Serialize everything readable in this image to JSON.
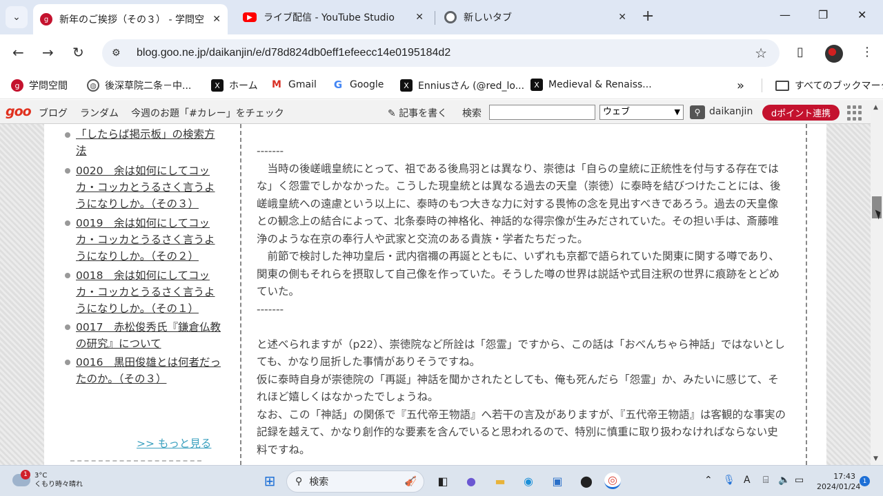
{
  "tabs": [
    {
      "title": "新年のご挨拶（その３） - 学問空",
      "close": "✕",
      "favicon_color": "#c4122e",
      "active": true
    },
    {
      "title": "ライブ配信 - YouTube Studio",
      "close": "✕",
      "favicon_color": "#ff0000",
      "active": false
    },
    {
      "title": "新しいタブ",
      "close": "✕",
      "favicon_color": "#5f6368",
      "active": false
    }
  ],
  "newtab": "+",
  "window": {
    "minimize": "—",
    "restore": "❐",
    "close": "✕"
  },
  "toolbar": {
    "url": "blog.goo.ne.jp/daikanjin/e/d78d824db0eff1efeecc14e0195184d2"
  },
  "bookmarks": [
    {
      "label": "学問空間",
      "icon": "goo-icon"
    },
    {
      "label": "後深草院二条－中...",
      "icon": "globe-icon"
    },
    {
      "label": "ホーム",
      "icon": "x-icon"
    },
    {
      "label": "Gmail",
      "icon": "gmail-icon"
    },
    {
      "label": "Google",
      "icon": "google-icon"
    },
    {
      "label": "Enniusさん (@red_lo...",
      "icon": "x-icon"
    },
    {
      "label": "Medieval & Renaiss...",
      "icon": "x-icon"
    }
  ],
  "bookmarks_overflow": "»",
  "all_bookmarks": "すべてのブックマーク",
  "goo": {
    "logo": "goo",
    "links": [
      "ブログ",
      "ランダム",
      "今週のお題「#カレー」をチェック"
    ],
    "write": "記事を書く",
    "search_label": "検索",
    "select_value": "ウェブ",
    "user": "daikanjin",
    "dpoint": "dポイント連携"
  },
  "sidebar": {
    "items": [
      "「したらば掲示板」の検索方法",
      "0020　余は如何にしてコッカ・コッカとうるさく言うようになりしか。（その３）",
      "0019　余は如何にしてコッカ・コッカとうるさく言うようになりしか。（その２）",
      "0018　余は如何にしてコッカ・コッカとうるさく言うようになりしか。（その１）",
      "0017　赤松俊秀氏『鎌倉仏教の研究』について",
      "0016　黒田俊雄とは何者だったのか。（その３）"
    ],
    "more": ">> もっと見る"
  },
  "article": {
    "p1": "-------",
    "p2": "　当時の後嵯峨皇統にとって、祖である後鳥羽とは異なり、崇徳は「自らの皇統に正統性を付与する存在ではな」く怨霊でしかなかった。こうした現皇統とは異なる過去の天皇（崇徳）に泰時を結びつけたことには、後嵯峨皇統への遠慮という以上に、泰時のもつ大きな力に対する畏怖の念を見出すべきであろう。過去の天皇像との観念上の結合によって、北条泰時の神格化、神話的な得宗像が生みだされていた。その担い手は、斎藤唯浄のような在京の奉行人や武家と交流のある貴族・学者たちだった。",
    "p3": "　前節で検討した神功皇后・武内宿禰の再誕とともに、いずれも京都で語られていた関東に関する噂であり、関東の側もそれらを摂取して自己像を作っていた。そうした噂の世界は説話や式目注釈の世界に痕跡をとどめていた。",
    "p4": "-------",
    "p5": "と述べられますが（p22）、崇徳院など所詮は「怨霊」ですから、この話は「おべんちゃら神話」ではないとしても、かなり屈折した事情がありそうですね。",
    "p6": "仮に泰時自身が崇徳院の「再誕」神話を聞かされたとしても、俺も死んだら「怨霊」か、みたいに感じて、それほど嬉しくはなかったでしょうね。",
    "p7": "なお、この「神話」の関係で『五代帝王物語』へ若干の言及がありますが、『五代帝王物語』は客観的な事実の記録を越えて、かなり創作的な要素を含んでいると思われるので、特別に慎重に取り扱わなければならない史料ですね。"
  },
  "taskbar": {
    "weather_badge": "1",
    "temperature": "3°C",
    "weather": "くもり時々晴れ",
    "search": "検索",
    "ime": "A",
    "time": "17:43",
    "date": "2024/01/24",
    "notifications": "1"
  }
}
